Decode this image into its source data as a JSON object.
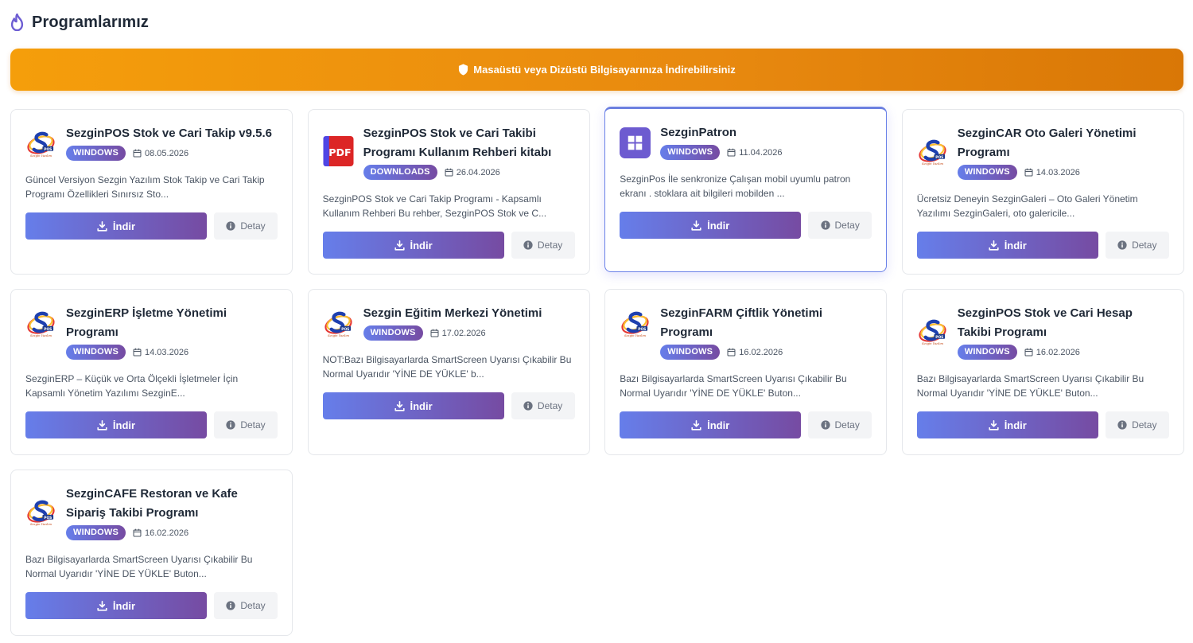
{
  "header": {
    "title": "Programlarımız",
    "icon": "fire-icon",
    "icon_color": "#6d5dd3"
  },
  "banner": {
    "text": "Masaüstü veya Dizüstü Bilgisayarınıza İndirebilirsiniz",
    "icon": "shield-icon",
    "color": "#f59e0b"
  },
  "accent": "#667eea",
  "buttons": {
    "download": "İndir",
    "detail": "Detay"
  },
  "programs": [
    {
      "title": "SezginPOS Stok ve Cari Takip v9.5.6",
      "badge": "WINDOWS",
      "date": "08.05.2026",
      "logo": "sezgin-pos-logo",
      "desc": "Güncel Versiyon Sezgin Yazılım Stok Takip ve Cari Takip Programı Özellikleri Sınırsız Sto..."
    },
    {
      "title": "SezginPOS Stok ve Cari Takibi Programı Kullanım Rehberi kitabı",
      "badge": "DOWNLOADS",
      "date": "26.04.2026",
      "logo": "pdf-icon",
      "desc": "SezginPOS Stok ve Cari Takip Programı - Kapsamlı Kullanım Rehberi Bu rehber, SezginPOS Stok ve C..."
    },
    {
      "title": "SezginPatron",
      "badge": "WINDOWS",
      "date": "11.04.2026",
      "logo": "windows-icon",
      "desc": "SezginPos İle senkronize Çalışan mobil uyumlu patron ekranı . stoklara ait bilgileri mobilden ..."
    },
    {
      "title": "SezginCAR Oto Galeri Yönetimi Programı",
      "badge": "WINDOWS",
      "date": "14.03.2026",
      "logo": "sezgin-car-logo",
      "desc": "Ücretsiz Deneyin SezginGaleri – Oto Galeri Yönetim Yazılımı SezginGaleri, oto galericile..."
    },
    {
      "title": "SezginERP İşletme Yönetimi Programı",
      "badge": "WINDOWS",
      "date": "14.03.2026",
      "logo": "sezgin-erp-logo",
      "desc": "SezginERP – Küçük ve Orta Ölçekli İşletmeler İçin Kapsamlı Yönetim Yazılımı SezginE..."
    },
    {
      "title": "Sezgin Eğitim Merkezi Yönetimi",
      "badge": "WINDOWS",
      "date": "17.02.2026",
      "logo": "sezgin-egitim-logo",
      "desc": "NOT:Bazı Bilgisayarlarda SmartScreen Uyarısı Çıkabilir Bu Normal Uyarıdır 'YİNE DE YÜKLE' b..."
    },
    {
      "title": "SezginFARM Çiftlik Yönetimi Programı",
      "badge": "WINDOWS",
      "date": "16.02.2026",
      "logo": "sezgin-farm-logo",
      "desc": "Bazı Bilgisayarlarda SmartScreen Uyarısı Çıkabilir Bu Normal Uyarıdır 'YİNE DE YÜKLE' Buton..."
    },
    {
      "title": "SezginPOS Stok ve Cari Hesap Takibi Programı",
      "badge": "WINDOWS",
      "date": "16.02.2026",
      "logo": "sezgin-pos-logo",
      "desc": "Bazı Bilgisayarlarda SmartScreen Uyarısı Çıkabilir Bu Normal Uyarıdır 'YİNE DE YÜKLE' Buton..."
    },
    {
      "title": "SezginCAFE Restoran ve Kafe Sipariş Takibi Programı",
      "badge": "WINDOWS",
      "date": "16.02.2026",
      "logo": "sezgin-cafe-logo",
      "desc": "Bazı Bilgisayarlarda SmartScreen Uyarısı Çıkabilir Bu Normal Uyarıdır 'YİNE DE YÜKLE' Buton..."
    }
  ]
}
